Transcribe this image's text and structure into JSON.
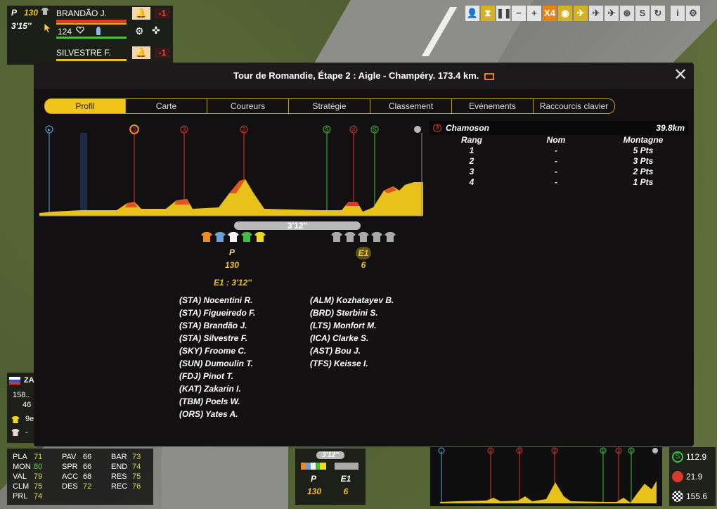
{
  "title": "Tour de Romandie, Étape 2 : Aigle - Champéry. 173.4 km.",
  "tabs": [
    "Profil",
    "Carte",
    "Coureurs",
    "Stratégie",
    "Classement",
    "Evénements",
    "Raccourcis clavier"
  ],
  "active_tab": "Profil",
  "rider_panel": {
    "group_label": "P",
    "group_number": "130",
    "time": "3'15''",
    "rider1": {
      "name": "BRANDÃO J.",
      "value": "124",
      "penalty": "-1"
    },
    "rider2": {
      "name": "SILVESTRE F.",
      "penalty": "-1"
    }
  },
  "toolbar": {
    "speed": "X4"
  },
  "climb_info": {
    "badge": "3",
    "name": "Chamoson",
    "distance": "39.8km",
    "headers": [
      "Rang",
      "Nom",
      "Montagne"
    ],
    "rows": [
      [
        "1",
        "-",
        "5 Pts"
      ],
      [
        "2",
        "-",
        "3 Pts"
      ],
      [
        "3",
        "-",
        "2 Pts"
      ],
      [
        "4",
        "-",
        "1 Pts"
      ]
    ]
  },
  "profile_markers": [
    "3",
    "3",
    "2",
    "S",
    "3",
    "S"
  ],
  "gap_bar": "3'12''",
  "group_p": {
    "label": "P",
    "count": "130"
  },
  "group_e1": {
    "label": "E1",
    "count": "6"
  },
  "e1_summary": "E1 : 3'12''",
  "group_p_riders": [
    "(STA) Nocentini R.",
    "(STA) Figueiredo F.",
    "(STA) Brandão J.",
    "(STA) Silvestre F.",
    "(SKY) Froome C.",
    "(SUN) Dumoulin T.",
    "(FDJ) Pinot T.",
    "(KAT) Zakarin I.",
    "(TBM) Poels W.",
    "(ORS) Yates A."
  ],
  "group_e1_riders": [
    "(ALM) Kozhatayev B.",
    "(BRD) Sterbini S.",
    "(LTS) Monfort M.",
    "(ICA) Clarke S.",
    "(AST) Bou J.",
    "(TFS) Keisse I."
  ],
  "left_side": {
    "name": "ZA",
    "value1": "158..",
    "value2": "46",
    "rank": "9e",
    "dash": "-"
  },
  "stats": [
    [
      "PLA",
      "71"
    ],
    [
      "PAV",
      "66"
    ],
    [
      "BAR",
      "73"
    ],
    [
      "MON",
      "80"
    ],
    [
      "SPR",
      "66"
    ],
    [
      "END",
      "74"
    ],
    [
      "VAL",
      "79"
    ],
    [
      "ACC",
      "68"
    ],
    [
      "RES",
      "75"
    ],
    [
      "CLM",
      "75"
    ],
    [
      "DES",
      "72"
    ],
    [
      "REC",
      "76"
    ],
    [
      "PRL",
      "74"
    ]
  ],
  "bottom_groups": {
    "gap": "3'12''",
    "p": "P",
    "p_count": "130",
    "e1": "E1",
    "e1_count": "6"
  },
  "distances": [
    "112.9",
    "21.9",
    "155.6"
  ],
  "colors": {
    "accent": "#f0c419",
    "modal_bg": "#121010",
    "climb_red": "#d83a2a",
    "sprint_green": "#3fbf3f"
  }
}
